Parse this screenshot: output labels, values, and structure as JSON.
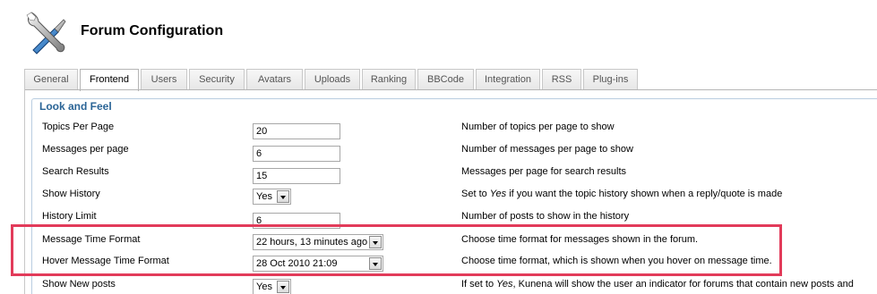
{
  "header": {
    "title": "Forum Configuration",
    "logo_icon": "tools-icon"
  },
  "tabs": [
    {
      "label": "General"
    },
    {
      "label": "Frontend",
      "active": true
    },
    {
      "label": "Users"
    },
    {
      "label": "Security"
    },
    {
      "label": "Avatars"
    },
    {
      "label": "Uploads"
    },
    {
      "label": "Ranking"
    },
    {
      "label": "BBCode"
    },
    {
      "label": "Integration"
    },
    {
      "label": "RSS"
    },
    {
      "label": "Plug-ins"
    }
  ],
  "section": {
    "legend": "Look and Feel",
    "rows": [
      {
        "label": "Topics Per Page",
        "type": "input",
        "value": "20",
        "desc": "Number of topics per page to show"
      },
      {
        "label": "Messages per page",
        "type": "input",
        "value": "6",
        "desc": "Number of messages per page to show"
      },
      {
        "label": "Search Results",
        "type": "input",
        "value": "15",
        "desc": "Messages per page for search results"
      },
      {
        "label": "Show History",
        "type": "select",
        "value": "Yes",
        "desc_pre": "Set to ",
        "desc_em": "Yes",
        "desc_post": " if you want the topic history shown when a reply/quote is made"
      },
      {
        "label": "History Limit",
        "type": "input",
        "value": "6",
        "desc": "Number of posts to show in the history"
      },
      {
        "label": "Message Time Format",
        "type": "select",
        "value": "22 hours, 13 minutes ago",
        "desc": "Choose time format for messages shown in the forum."
      },
      {
        "label": "Hover Message Time Format",
        "type": "select",
        "value": "28 Oct 2010 21:09",
        "desc": "Choose time format, which is shown when you hover on message time."
      },
      {
        "label": "Show New posts",
        "type": "select",
        "value": "Yes",
        "desc_pre": "If set to ",
        "desc_em": "Yes",
        "desc_post": ", Kunena will show the user an indicator for forums that contain new posts and"
      }
    ]
  },
  "colors": {
    "highlight": "#e23b5a",
    "legend": "#2a6496"
  }
}
